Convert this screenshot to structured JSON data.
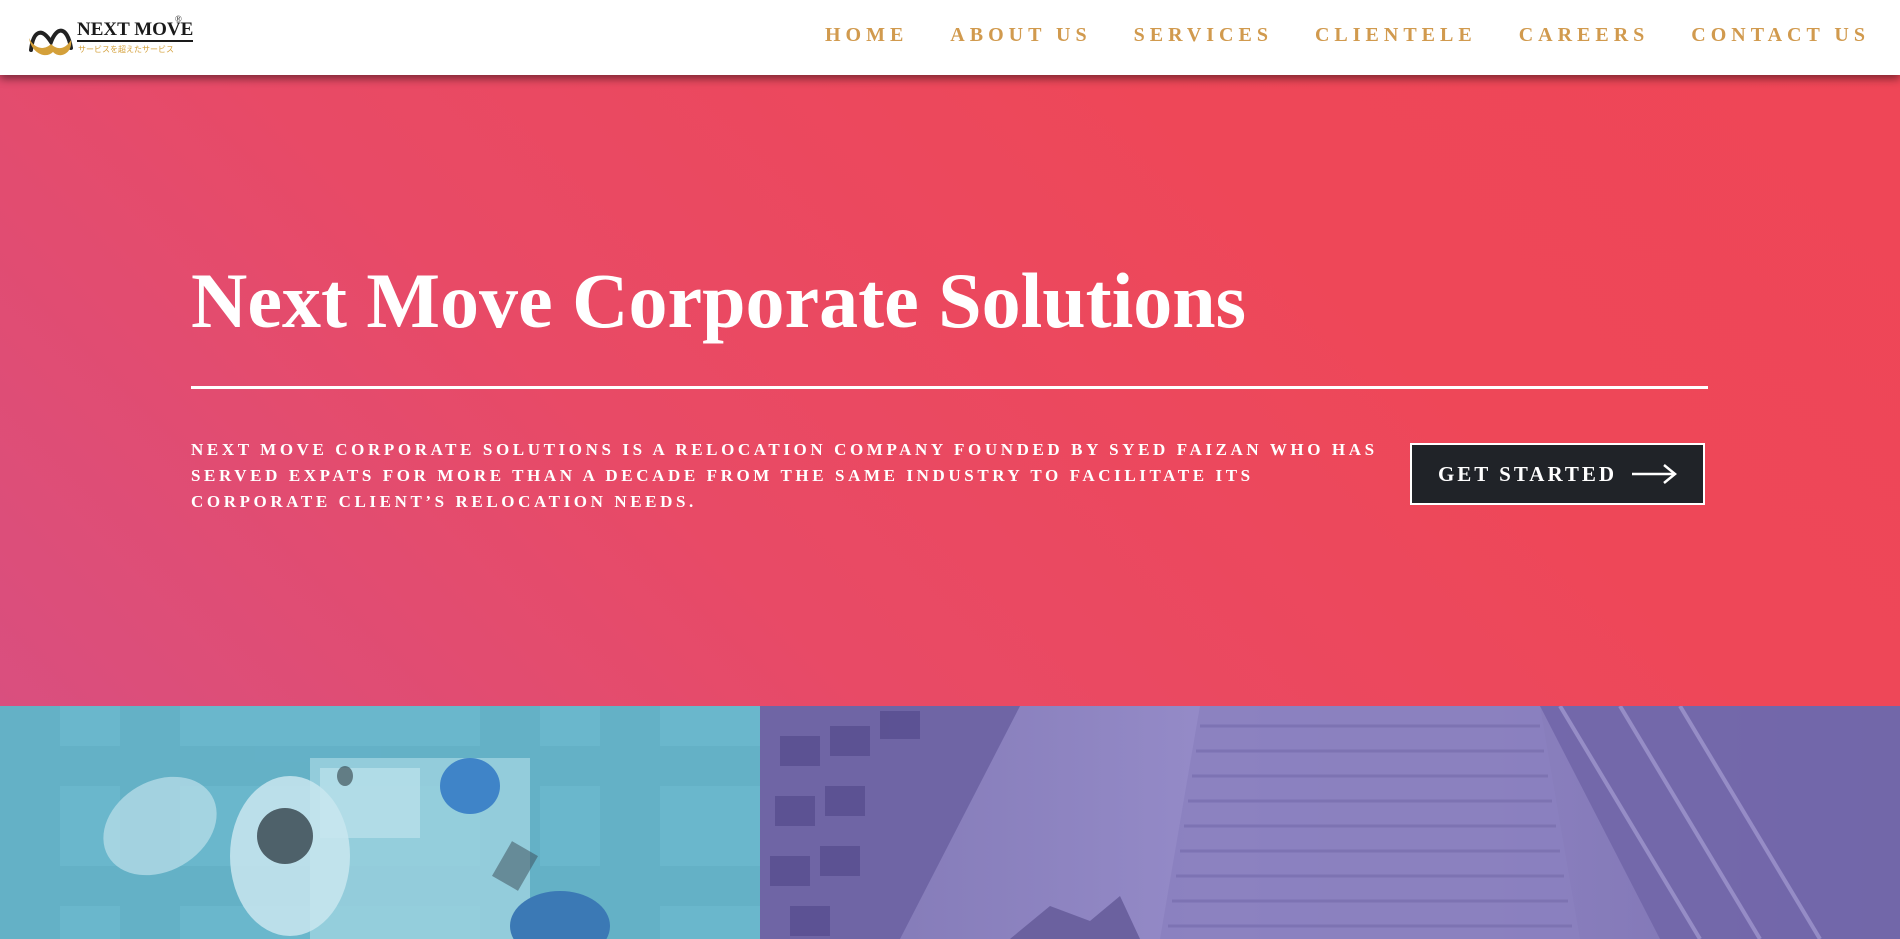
{
  "header": {
    "logo": {
      "name": "NEXT MOVE",
      "registered": "®",
      "tagline": "サービスを超えたサービス"
    },
    "nav": [
      {
        "label": "HOME"
      },
      {
        "label": "ABOUT US"
      },
      {
        "label": "SERVICES"
      },
      {
        "label": "CLIENTELE"
      },
      {
        "label": "CAREERS"
      },
      {
        "label": "CONTACT US"
      }
    ]
  },
  "hero": {
    "title": "Next Move Corporate Solutions",
    "description": "NEXT MOVE CORPORATE SOLUTIONS IS A RELOCATION COMPANY FOUNDED BY SYED FAIZAN WHO HAS SERVED EXPATS FOR MORE THAN A DECADE FROM THE SAME INDUSTRY TO FACILITATE ITS CORPORATE CLIENT’S RELOCATION NEEDS.",
    "cta_label": "GET STARTED",
    "cta_icon": "arrow-right-icon"
  },
  "colors": {
    "accent_gold": "#d19a4e",
    "hero_red": "#ee4758",
    "hero_pink": "#d94f7f",
    "button_dark": "#202328",
    "panel_teal": "#6ab7cc",
    "panel_purple": "#8a80bb"
  }
}
